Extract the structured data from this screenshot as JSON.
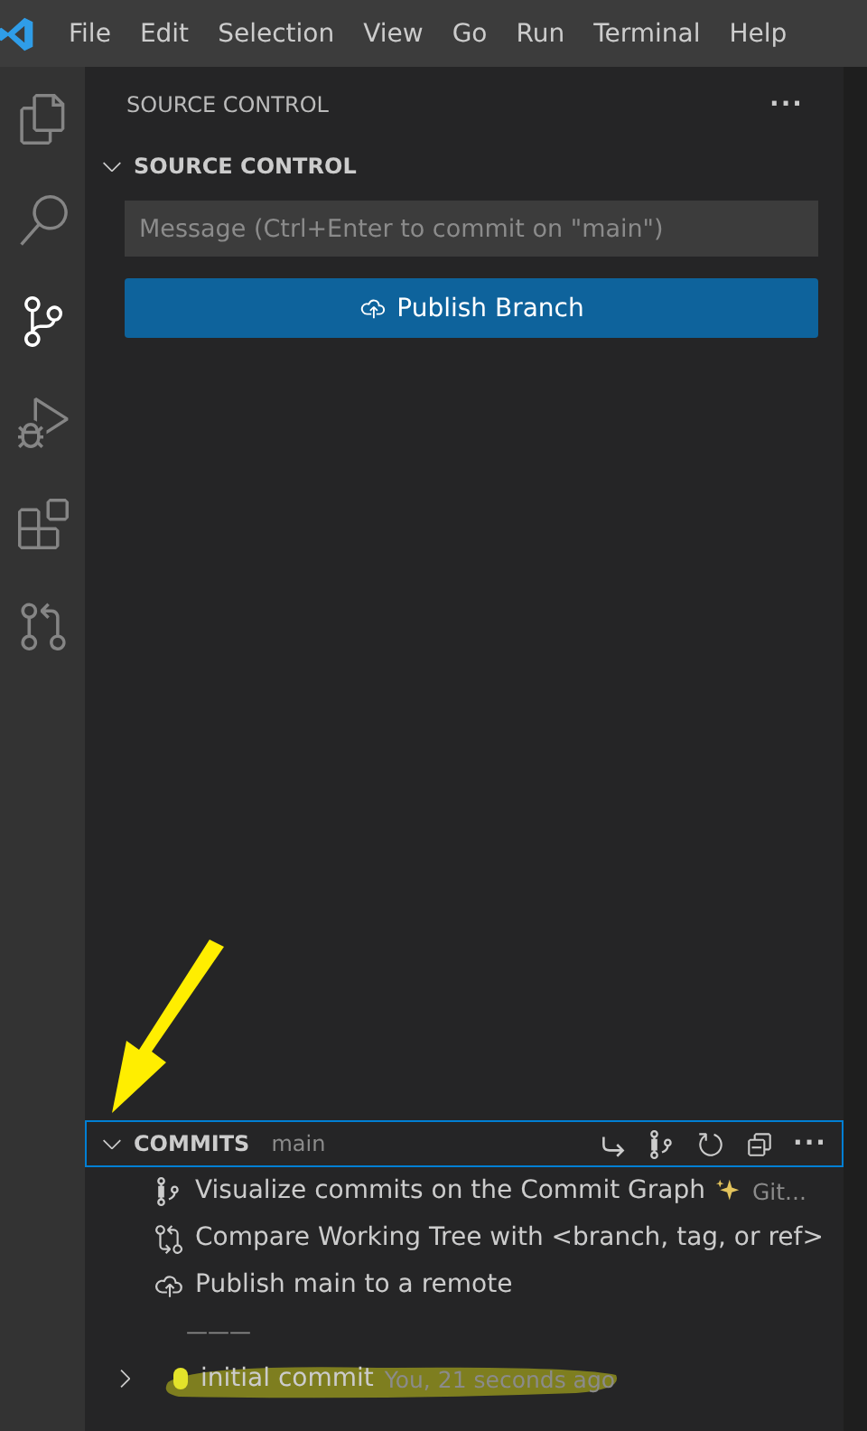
{
  "menu_bar": {
    "items": [
      "File",
      "Edit",
      "Selection",
      "View",
      "Go",
      "Run",
      "Terminal",
      "Help"
    ]
  },
  "activity_bar": {
    "items": [
      {
        "kind": "files",
        "selected": false
      },
      {
        "kind": "search",
        "selected": false
      },
      {
        "kind": "scm",
        "selected": true
      },
      {
        "kind": "debug",
        "selected": false
      },
      {
        "kind": "extensions",
        "selected": false
      },
      {
        "kind": "git",
        "selected": false
      }
    ]
  },
  "sidebar": {
    "title": "SOURCE CONTROL",
    "more": "···",
    "source_control": {
      "title": "SOURCE CONTROL",
      "expanded": true,
      "message_placeholder": "Message (Ctrl+Enter to commit on \"main\")",
      "publish_button": "Publish Branch"
    },
    "commits": {
      "title": "COMMITS",
      "branch": "main",
      "expanded": true,
      "more": "···",
      "actions": [
        {
          "kind": "graph",
          "text": "Visualize commits on the Commit Graph",
          "extra": "Git..."
        },
        {
          "kind": "compare",
          "text": "Compare Working Tree with <branch, tag, or ref>"
        },
        {
          "kind": "publish",
          "text": "Publish main to a remote"
        }
      ],
      "separator": "———",
      "commit_rows": [
        {
          "message": "initial commit",
          "meta": "You, 21 seconds ago",
          "expanded": false
        }
      ]
    }
  }
}
